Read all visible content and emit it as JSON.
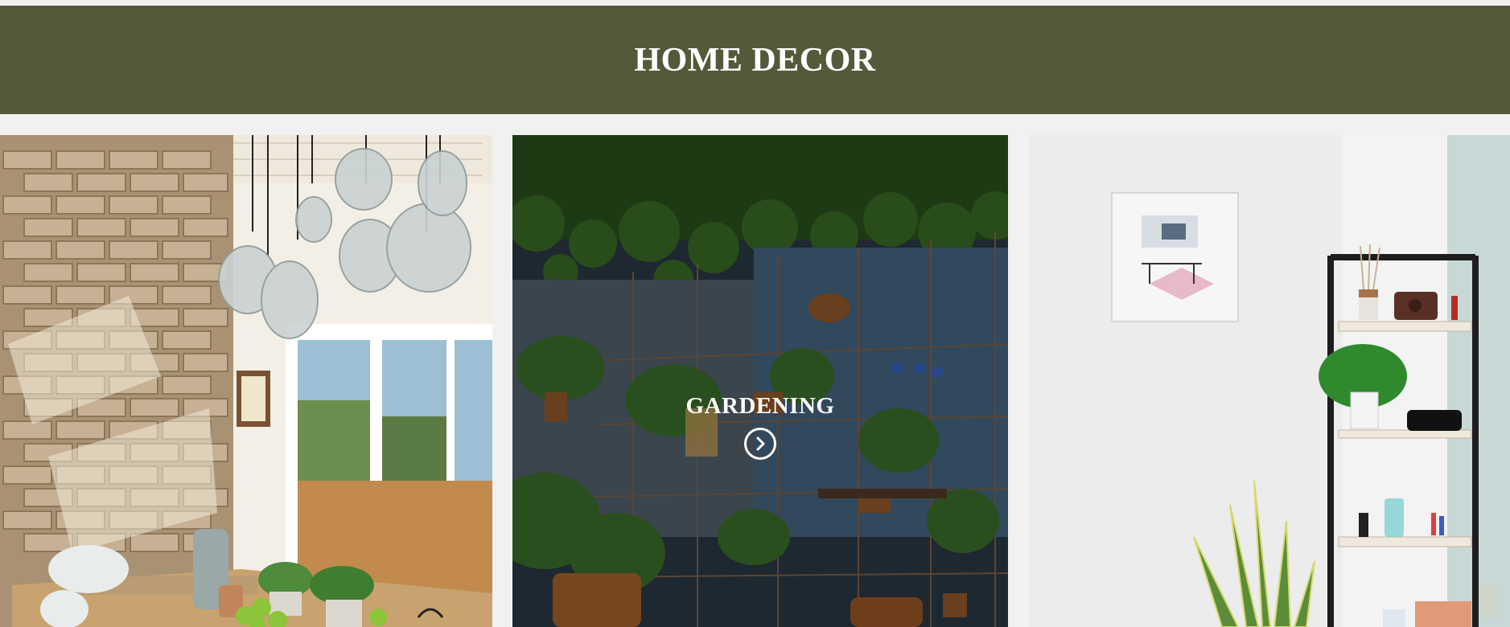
{
  "header": {
    "title": "HOME DECOR"
  },
  "tiles": [
    {
      "label": "",
      "image": "dining-room-pendant-lights-photo"
    },
    {
      "label": "GARDENING",
      "image": "indoor-garden-shelves-photo",
      "icon": "chevron-right-circle-icon"
    },
    {
      "label": "",
      "image": "white-room-ladder-shelf-photo"
    }
  ],
  "colors": {
    "header_bg": "#525a3a",
    "page_bg": "#f1f1f1",
    "title": "#ffffff"
  }
}
